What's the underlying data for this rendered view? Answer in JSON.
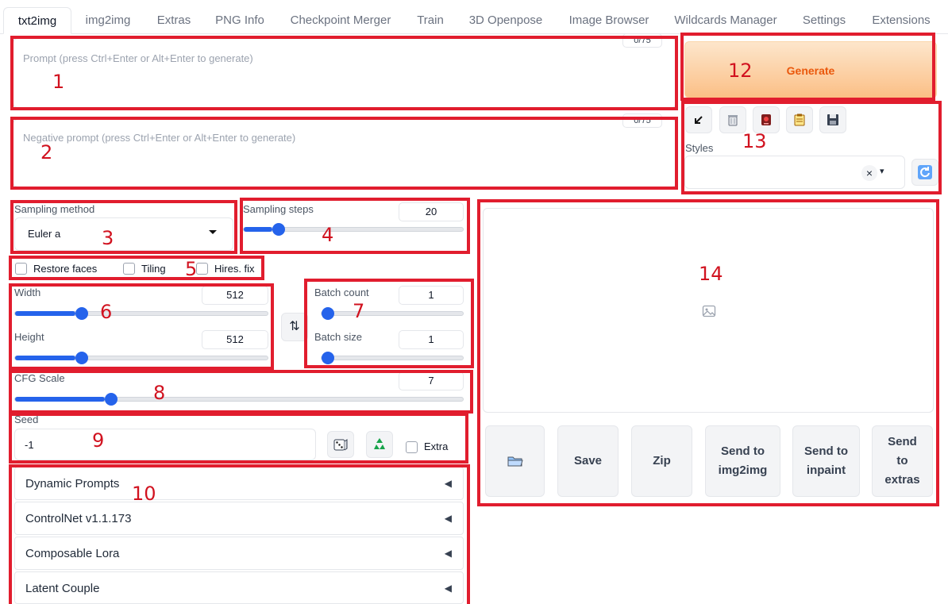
{
  "tabs": [
    "txt2img",
    "img2img",
    "Extras",
    "PNG Info",
    "Checkpoint Merger",
    "Train",
    "3D Openpose",
    "Image Browser",
    "Wildcards Manager",
    "Settings",
    "Extensions"
  ],
  "prompt": {
    "placeholder": "Prompt (press Ctrl+Enter or Alt+Enter to generate)",
    "counter": "0/75"
  },
  "negative_prompt": {
    "placeholder": "Negative prompt (press Ctrl+Enter or Alt+Enter to generate)",
    "counter": "0/75"
  },
  "generate_label": "Generate",
  "tool_icons": [
    "arrow-icon",
    "trash-icon",
    "red-card-icon",
    "clipboard-icon",
    "save-icon"
  ],
  "styles": {
    "label": "Styles",
    "clear_glyph": "×",
    "caret_glyph": "▾"
  },
  "sampling_method": {
    "label": "Sampling method",
    "value": "Euler a"
  },
  "sampling_steps": {
    "label": "Sampling steps",
    "value": "20",
    "level": 0.13
  },
  "checkboxes": [
    "Restore faces",
    "Tiling",
    "Hires. fix"
  ],
  "width": {
    "label": "Width",
    "value": "512",
    "level": 0.24
  },
  "height": {
    "label": "Height",
    "value": "512",
    "level": 0.24
  },
  "swap_glyph": "⇅",
  "batch_count": {
    "label": "Batch count",
    "value": "1",
    "level": 0.0
  },
  "batch_size": {
    "label": "Batch size",
    "value": "1",
    "level": 0.0
  },
  "cfg_scale": {
    "label": "CFG Scale",
    "value": "7",
    "level": 0.2
  },
  "seed": {
    "label": "Seed",
    "value": "-1",
    "extra_label": "Extra"
  },
  "accordions": [
    "Dynamic Prompts",
    "ControlNet v1.1.173",
    "Composable Lora",
    "Latent Couple"
  ],
  "accordion_arrow": "◀",
  "gallery_buttons": [
    "Save",
    "Zip",
    "Send to img2img",
    "Send to inpaint",
    "Send to extras"
  ],
  "annotations": [
    "1",
    "2",
    "3",
    "4",
    "5",
    "6",
    "7",
    "8",
    "9",
    "10",
    "12",
    "13",
    "14"
  ],
  "colors": {
    "annotation": "#e11d2e",
    "accent": "#2563eb",
    "generate_text": "#ea580c"
  }
}
